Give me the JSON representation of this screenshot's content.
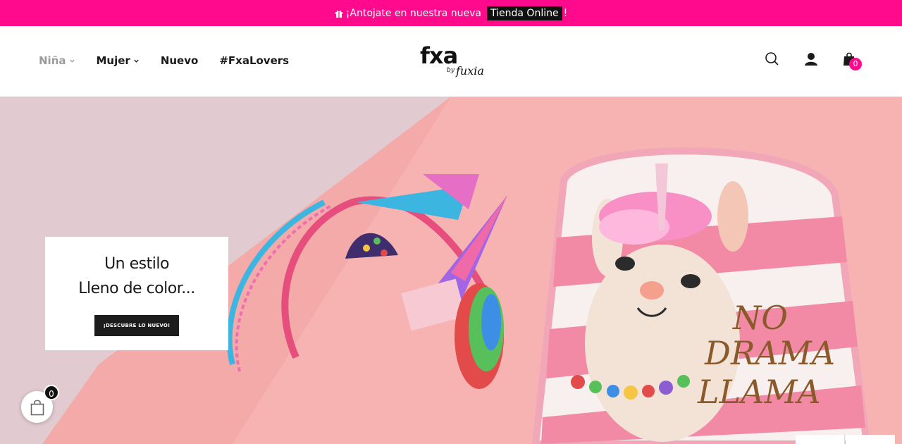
{
  "promo": {
    "text": "¡Antojate en nuestra nueva",
    "highlight": "Tienda Online",
    "suffix": "!",
    "icon": "gift-icon",
    "background": "#ff0a8c"
  },
  "nav": {
    "items": [
      {
        "label": "Niña",
        "has_dropdown": true,
        "active": true
      },
      {
        "label": "Mujer",
        "has_dropdown": true
      },
      {
        "label": "Nuevo",
        "has_dropdown": false
      },
      {
        "label": "#FxaLovers",
        "has_dropdown": false
      }
    ]
  },
  "logo": {
    "brand": "fxa",
    "by": "by",
    "script": "fuxia"
  },
  "header_icons": {
    "search": "search-icon",
    "account": "user-icon",
    "cart": "shopping-bag-icon",
    "cart_count": "0"
  },
  "hero": {
    "line1": "Un estilo",
    "line2": "Lleno de color...",
    "cta_label": "¡DESCUBRE LO NUEVO!"
  },
  "floating_cart": {
    "count": "0",
    "icon": "shopping-bag-icon"
  }
}
